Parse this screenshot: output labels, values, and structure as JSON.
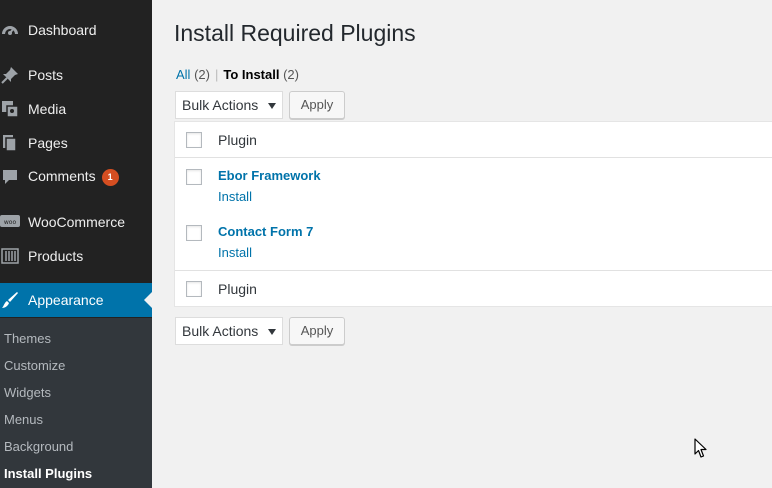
{
  "sidebar": {
    "items": [
      {
        "label": "Dashboard",
        "icon": "dashboard-icon"
      },
      {
        "label": "Posts",
        "icon": "pin-icon"
      },
      {
        "label": "Media",
        "icon": "media-icon"
      },
      {
        "label": "Pages",
        "icon": "pages-icon"
      },
      {
        "label": "Comments",
        "icon": "comment-icon",
        "badge": "1"
      },
      {
        "label": "WooCommerce",
        "icon": "woocommerce-icon"
      },
      {
        "label": "Products",
        "icon": "products-icon"
      },
      {
        "label": "Appearance",
        "icon": "brush-icon",
        "active": true
      }
    ],
    "submenu": [
      {
        "label": "Themes"
      },
      {
        "label": "Customize"
      },
      {
        "label": "Widgets"
      },
      {
        "label": "Menus"
      },
      {
        "label": "Background"
      },
      {
        "label": "Install Plugins",
        "current": true
      }
    ]
  },
  "main": {
    "title": "Install Required Plugins",
    "filters": {
      "all_label": "All",
      "all_count": "(2)",
      "separator": "|",
      "to_install_label": "To Install",
      "to_install_count": "(2)"
    },
    "bulk_actions_top": "Bulk Actions",
    "apply_top": "Apply",
    "bulk_actions_bottom": "Bulk Actions",
    "apply_bottom": "Apply",
    "table": {
      "column_header": "Plugin",
      "column_footer": "Plugin",
      "rows": [
        {
          "name": "Ebor Framework",
          "action": "Install"
        },
        {
          "name": "Contact Form 7",
          "action": "Install"
        }
      ]
    }
  },
  "colors": {
    "sidebar_bg": "#222222",
    "active_bg": "#0073aa",
    "link": "#0073aa",
    "badge": "#d54e21",
    "content_bg": "#f1f1f1"
  }
}
